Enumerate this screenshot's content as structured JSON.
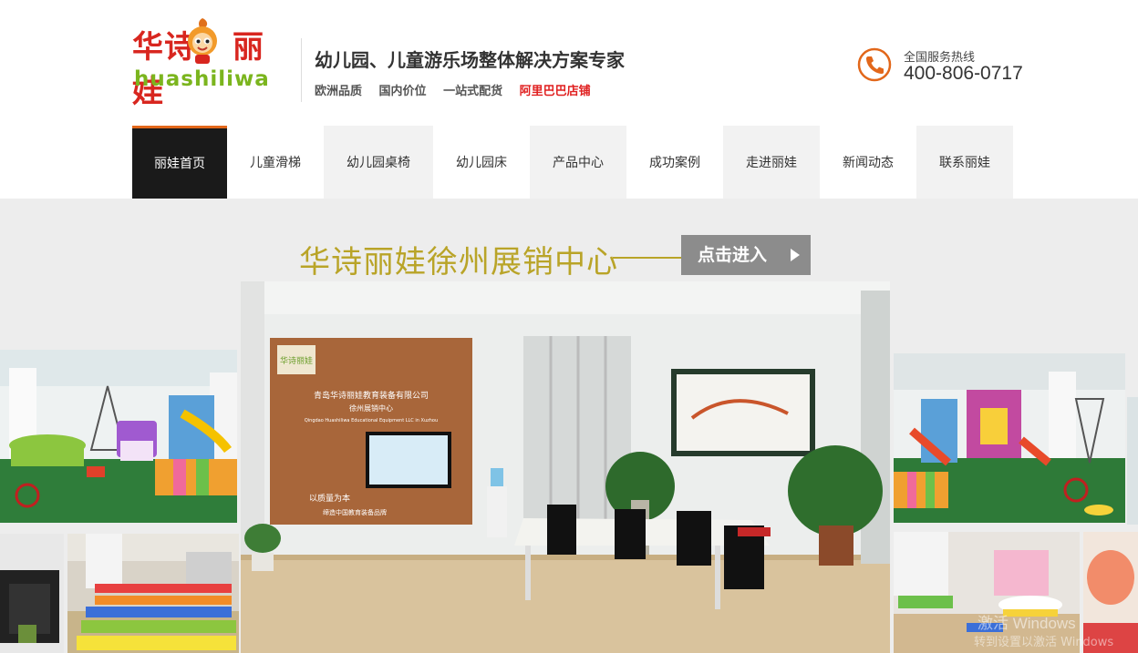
{
  "logo": {
    "cn_part1": "华诗",
    "cn_part2": "丽娃",
    "pinyin": "huashiliwa"
  },
  "slogan": "幼儿园、儿童游乐场整体解决方案专家",
  "features": [
    "欧洲品质",
    "国内价位",
    "一站式配货"
  ],
  "alibaba_link": "阿里巴巴店铺",
  "hotline": {
    "label": "全国服务热线",
    "number": "400-806-0717"
  },
  "nav": [
    {
      "label": "丽娃首页",
      "active": true
    },
    {
      "label": "儿童滑梯"
    },
    {
      "label": "幼儿园桌椅"
    },
    {
      "label": "幼儿园床"
    },
    {
      "label": "产品中心"
    },
    {
      "label": "成功案例"
    },
    {
      "label": "走进丽娃"
    },
    {
      "label": "新闻动态"
    },
    {
      "label": "联系丽娃"
    }
  ],
  "banner": {
    "title": "华诗丽娃徐州展销中心",
    "enter_label": "点击进入",
    "wall_sign_company": "青岛华诗丽娃教育装备有限公司",
    "wall_sign_center": "徐州展销中心",
    "wall_sign_en": "Qingdao Huashiliwa Educational Equipment LLC in Xuzhou",
    "wall_slogan_1": "以质量为本",
    "wall_slogan_2": "缔造中国教育装备品牌",
    "board_logo": "华诗丽娃"
  },
  "watermark": {
    "line1": "激活 Windows",
    "line2": "转到设置以激活 Windows"
  },
  "colors": {
    "accent_orange": "#e2671a",
    "brand_red": "#d8261f",
    "brand_green": "#7bb51e",
    "banner_gold": "#b9a428",
    "nav_active_bg": "#1a1a1a"
  }
}
